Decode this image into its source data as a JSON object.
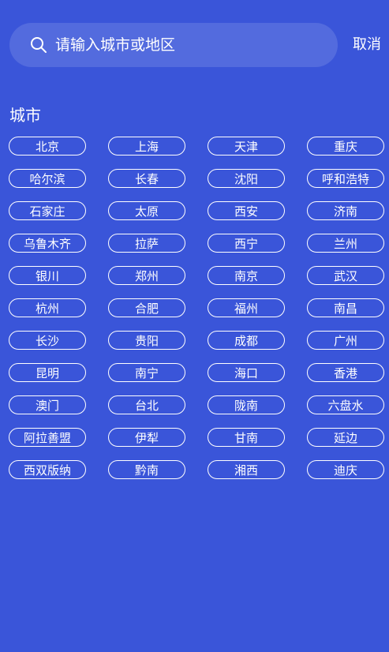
{
  "search": {
    "placeholder": "请输入城市或地区",
    "cancel_label": "取消"
  },
  "section": {
    "title": "城市"
  },
  "cities": [
    "北京",
    "上海",
    "天津",
    "重庆",
    "哈尔滨",
    "长春",
    "沈阳",
    "呼和浩特",
    "石家庄",
    "太原",
    "西安",
    "济南",
    "乌鲁木齐",
    "拉萨",
    "西宁",
    "兰州",
    "银川",
    "郑州",
    "南京",
    "武汉",
    "杭州",
    "合肥",
    "福州",
    "南昌",
    "长沙",
    "贵阳",
    "成都",
    "广州",
    "昆明",
    "南宁",
    "海口",
    "香港",
    "澳门",
    "台北",
    "陇南",
    "六盘水",
    "阿拉善盟",
    "伊犁",
    "甘南",
    "延边",
    "西双版纳",
    "黔南",
    "湘西",
    "迪庆"
  ],
  "colors": {
    "background": "#3a55d9",
    "foreground": "#ffffff"
  },
  "icons": {
    "search": "search-icon"
  }
}
